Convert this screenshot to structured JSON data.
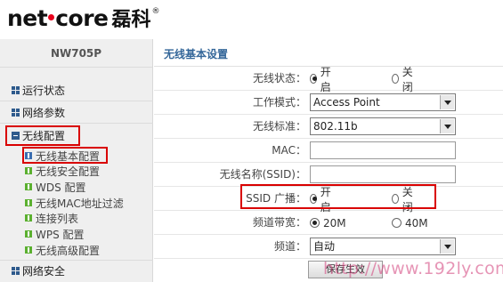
{
  "logo": {
    "brand_left": "net",
    "brand_right": "core",
    "chinese": "磊科",
    "registered": "®"
  },
  "sidebar": {
    "model": "NW705P",
    "groups": [
      {
        "label": "运行状态"
      },
      {
        "label": "网络参数"
      },
      {
        "label": "无线配置"
      },
      {
        "label": "网络安全"
      }
    ],
    "subitems": [
      {
        "label": "无线基本配置"
      },
      {
        "label": "无线安全配置"
      },
      {
        "label": "WDS 配置"
      },
      {
        "label": "无线MAC地址过滤"
      },
      {
        "label": "连接列表"
      },
      {
        "label": "WPS 配置"
      },
      {
        "label": "无线高级配置"
      }
    ]
  },
  "main": {
    "title": "无线基本设置",
    "fields": {
      "wireless_status": {
        "label": "无线状态：",
        "on": "开启",
        "off": "关闭"
      },
      "work_mode": {
        "label": "工作模式：",
        "value": "Access Point"
      },
      "wireless_standard": {
        "label": "无线标准：",
        "value": "802.11b"
      },
      "mac": {
        "label": "MAC：",
        "value": ""
      },
      "ssid": {
        "label": "无线名称(SSID)：",
        "value": ""
      },
      "ssid_broadcast": {
        "label": "SSID 广播：",
        "on": "开启",
        "off": "关闭"
      },
      "bandwidth": {
        "label": "频道带宽：",
        "opt1": "20M",
        "opt2": "40M"
      },
      "channel": {
        "label": "频道：",
        "value": "自动"
      }
    },
    "save_label": "保存生效"
  },
  "watermark": "http://www.192ly.com",
  "colors": {
    "highlight": "#d90000",
    "title": "#336699",
    "sidebar_bg": "#efefef",
    "logo_dot": "#e8001c"
  }
}
